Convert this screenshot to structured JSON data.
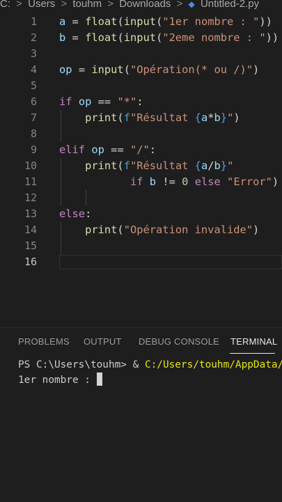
{
  "breadcrumb": {
    "items": [
      "C:",
      "Users",
      "touhm",
      "Downloads",
      "Untitled-2.py"
    ],
    "separator": ">"
  },
  "editor": {
    "active_line": 16,
    "lines": [
      {
        "n": "1",
        "tokens": [
          [
            "var",
            "a"
          ],
          [
            "op",
            " = "
          ],
          [
            "fn",
            "float"
          ],
          [
            "op",
            "("
          ],
          [
            "fn",
            "input"
          ],
          [
            "op",
            "("
          ],
          [
            "str",
            "\"1er nombre : \""
          ],
          [
            "op",
            "))"
          ]
        ]
      },
      {
        "n": "2",
        "tokens": [
          [
            "var",
            "b"
          ],
          [
            "op",
            " = "
          ],
          [
            "fn",
            "float"
          ],
          [
            "op",
            "("
          ],
          [
            "fn",
            "input"
          ],
          [
            "op",
            "("
          ],
          [
            "str",
            "\"2eme nombre : \""
          ],
          [
            "op",
            "))"
          ]
        ]
      },
      {
        "n": "3",
        "tokens": []
      },
      {
        "n": "4",
        "tokens": [
          [
            "var",
            "op"
          ],
          [
            "op",
            " = "
          ],
          [
            "fn",
            "input"
          ],
          [
            "op",
            "("
          ],
          [
            "str",
            "\"Opération(* ou /)\""
          ],
          [
            "op",
            ")"
          ]
        ]
      },
      {
        "n": "5",
        "tokens": []
      },
      {
        "n": "6",
        "tokens": [
          [
            "kw",
            "if"
          ],
          [
            "op",
            " "
          ],
          [
            "var",
            "op"
          ],
          [
            "op",
            " == "
          ],
          [
            "str",
            "\"*\""
          ],
          [
            "op",
            ":"
          ]
        ]
      },
      {
        "n": "7",
        "tokens": [
          [
            "op",
            "    "
          ],
          [
            "fn",
            "print"
          ],
          [
            "op",
            "("
          ],
          [
            "const",
            "f"
          ],
          [
            "str",
            "\"Résultat "
          ],
          [
            "const",
            "{"
          ],
          [
            "var",
            "a"
          ],
          [
            "op",
            "*"
          ],
          [
            "var",
            "b"
          ],
          [
            "const",
            "}"
          ],
          [
            "str",
            "\""
          ],
          [
            "op",
            ")"
          ]
        ]
      },
      {
        "n": "8",
        "tokens": []
      },
      {
        "n": "9",
        "tokens": [
          [
            "kw",
            "elif"
          ],
          [
            "op",
            " "
          ],
          [
            "var",
            "op"
          ],
          [
            "op",
            " == "
          ],
          [
            "str",
            "\"/\""
          ],
          [
            "op",
            ":"
          ]
        ]
      },
      {
        "n": "10",
        "tokens": [
          [
            "op",
            "    "
          ],
          [
            "fn",
            "print"
          ],
          [
            "op",
            "("
          ],
          [
            "const",
            "f"
          ],
          [
            "str",
            "\"Résultat "
          ],
          [
            "const",
            "{"
          ],
          [
            "var",
            "a"
          ],
          [
            "op",
            "/"
          ],
          [
            "var",
            "b"
          ],
          [
            "const",
            "}"
          ],
          [
            "str",
            "\""
          ]
        ]
      },
      {
        "n": "11",
        "tokens": [
          [
            "op",
            "           "
          ],
          [
            "kw",
            "if"
          ],
          [
            "op",
            " "
          ],
          [
            "var",
            "b"
          ],
          [
            "op",
            " != "
          ],
          [
            "num",
            "0"
          ],
          [
            "op",
            " "
          ],
          [
            "kw",
            "else"
          ],
          [
            "op",
            " "
          ],
          [
            "str",
            "\"Error\""
          ],
          [
            "op",
            ")"
          ]
        ]
      },
      {
        "n": "12",
        "tokens": []
      },
      {
        "n": "13",
        "tokens": [
          [
            "kw",
            "else"
          ],
          [
            "op",
            ":"
          ]
        ]
      },
      {
        "n": "14",
        "tokens": [
          [
            "op",
            "    "
          ],
          [
            "fn",
            "print"
          ],
          [
            "op",
            "("
          ],
          [
            "str",
            "\"Opération invalide\""
          ],
          [
            "op",
            ")"
          ]
        ]
      },
      {
        "n": "15",
        "tokens": []
      },
      {
        "n": "16",
        "tokens": []
      }
    ]
  },
  "panel": {
    "tabs": [
      "PROBLEMS",
      "OUTPUT",
      "DEBUG CONSOLE",
      "TERMINAL"
    ],
    "active_tab": "TERMINAL"
  },
  "terminal": {
    "prompt": "PS C:\\Users\\touhm> & ",
    "command_path": "C:/Users/touhm/AppData/L",
    "output_line": "1er nombre : "
  },
  "colors": {
    "background": "#1e1e1e",
    "keyword": "#c586c0",
    "function": "#dcdcaa",
    "string": "#ce9178",
    "variable": "#9cdcfe",
    "number": "#b5cea8",
    "terminal_path": "#e5e510"
  }
}
